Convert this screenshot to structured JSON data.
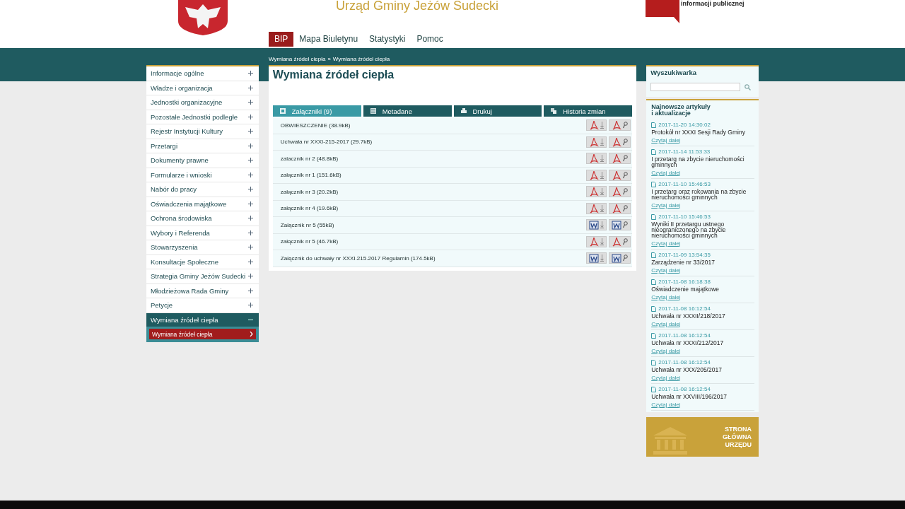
{
  "header": {
    "title": "Urząd Gminy Jeżów Sudecki",
    "bip_caption": "informacji publicznej"
  },
  "nav": [
    {
      "label": "BIP",
      "selected": true
    },
    {
      "label": "Mapa Biuletynu",
      "selected": false
    },
    {
      "label": "Statystyki",
      "selected": false
    },
    {
      "label": "Pomoc",
      "selected": false
    }
  ],
  "breadcrumb": {
    "items": [
      "Wymiana źródeł ciepła",
      "Wymiana źródeł ciepła"
    ],
    "separator": "»"
  },
  "sidebar": {
    "items": [
      {
        "label": "Informacje ogólne",
        "expanded": false
      },
      {
        "label": "Władze i organizacja",
        "expanded": false
      },
      {
        "label": "Jednostki organizacyjne",
        "expanded": false
      },
      {
        "label": "Pozostałe Jednostki podległe",
        "expanded": false
      },
      {
        "label": "Rejestr Instytucji Kultury",
        "expanded": false
      },
      {
        "label": "Przetargi",
        "expanded": false
      },
      {
        "label": "Dokumenty prawne",
        "expanded": false
      },
      {
        "label": "Formularze i wnioski",
        "expanded": false
      },
      {
        "label": "Nabór do pracy",
        "expanded": false
      },
      {
        "label": "Oświadczenia majątkowe",
        "expanded": false
      },
      {
        "label": "Ochrona środowiska",
        "expanded": false
      },
      {
        "label": "Wybory i Referenda",
        "expanded": false
      },
      {
        "label": "Stowarzyszenia",
        "expanded": false
      },
      {
        "label": "Konsultacje Społeczne",
        "expanded": false
      },
      {
        "label": "Strategia Gminy Jeżów Sudecki",
        "expanded": false
      },
      {
        "label": "Młodzieżowa Rada Gminy",
        "expanded": false
      },
      {
        "label": "Petycje",
        "expanded": false
      },
      {
        "label": "Wymiana źródeł ciepła",
        "expanded": true,
        "children": [
          {
            "label": "Wymiana źródeł ciepła",
            "selected": true
          }
        ]
      }
    ]
  },
  "main": {
    "title": "Wymiana źródeł ciepła",
    "tabs": [
      {
        "label": "Załączniki (9)",
        "kind": "attachments",
        "selected": true
      },
      {
        "label": "Metadane",
        "kind": "metadata",
        "selected": false
      },
      {
        "label": "Drukuj",
        "kind": "print",
        "selected": false
      },
      {
        "label": "Historia zmian",
        "kind": "history",
        "selected": false
      }
    ],
    "files": [
      {
        "name": "OBWIESZCZENIE (38.9kB)",
        "kind": "pdf"
      },
      {
        "name": "Uchwała nr XXXI-215-2017 (29.7kB)",
        "kind": "pdf"
      },
      {
        "name": "zalacznik nr 2 (48.8kB)",
        "kind": "pdf"
      },
      {
        "name": "załącznik nr 1 (151.6kB)",
        "kind": "pdf"
      },
      {
        "name": "załącznik nr 3 (20.2kB)",
        "kind": "pdf"
      },
      {
        "name": "załącznik nr 4 (19.6kB)",
        "kind": "pdf"
      },
      {
        "name": "Załącznik nr 5 (55kB)",
        "kind": "word"
      },
      {
        "name": "załącznik nr 5 (46.7kB)",
        "kind": "pdf"
      },
      {
        "name": "Załącznik do uchwały nr XXXI.215.2017 Regulamin (174.5kB)",
        "kind": "word"
      }
    ]
  },
  "search": {
    "title": "Wyszukiwarka"
  },
  "news": {
    "title_lines": [
      "Najnowsze artykuły",
      "i aktualizacje"
    ],
    "items": [
      {
        "date": "2017-11-20 14:30:02",
        "title": "Protokół nr XXXI Sesji Rady Gminy",
        "link": "Czytaj dalej"
      },
      {
        "date": "2017-11-14 11:53:33",
        "title": "I przetarg na zbycie nieruchomości gminnych",
        "link": "Czytaj dalej"
      },
      {
        "date": "2017-11-10 15:46:53",
        "title": "I przetarg oraz rokowania na zbycie nieruchomości gminnych",
        "link": "Czytaj dalej"
      },
      {
        "date": "2017-11-10 15:46:53",
        "title": "Wyniki II przetargu ustnego nieograniczonego na zbycie nieruchomości gminnych",
        "link": "Czytaj dalej"
      },
      {
        "date": "2017-11-09 13:54:35",
        "title": "Zarządzenie nr 33/2017",
        "link": "Czytaj dalej"
      },
      {
        "date": "2017-11-08 16:18:38",
        "title": "Oświadczenie majątkowe",
        "link": "Czytaj dalej"
      },
      {
        "date": "2017-11-08 16:12:54",
        "title": "Uchwała nr XXXII/218/2017",
        "link": "Czytaj dalej"
      },
      {
        "date": "2017-11-08 16:12:54",
        "title": "Uchwała nr XXXI/212/2017",
        "link": "Czytaj dalej"
      },
      {
        "date": "2017-11-08 16:12:54",
        "title": "Uchwała nr XXX/205/2017",
        "link": "Czytaj dalej"
      },
      {
        "date": "2017-11-08 16:12:54",
        "title": "Uchwała nr XXVIII/196/2017",
        "link": "Czytaj dalej"
      }
    ]
  },
  "banner": {
    "lines": [
      "STRONA",
      "GŁÓWNA",
      "URZĘDU"
    ]
  }
}
